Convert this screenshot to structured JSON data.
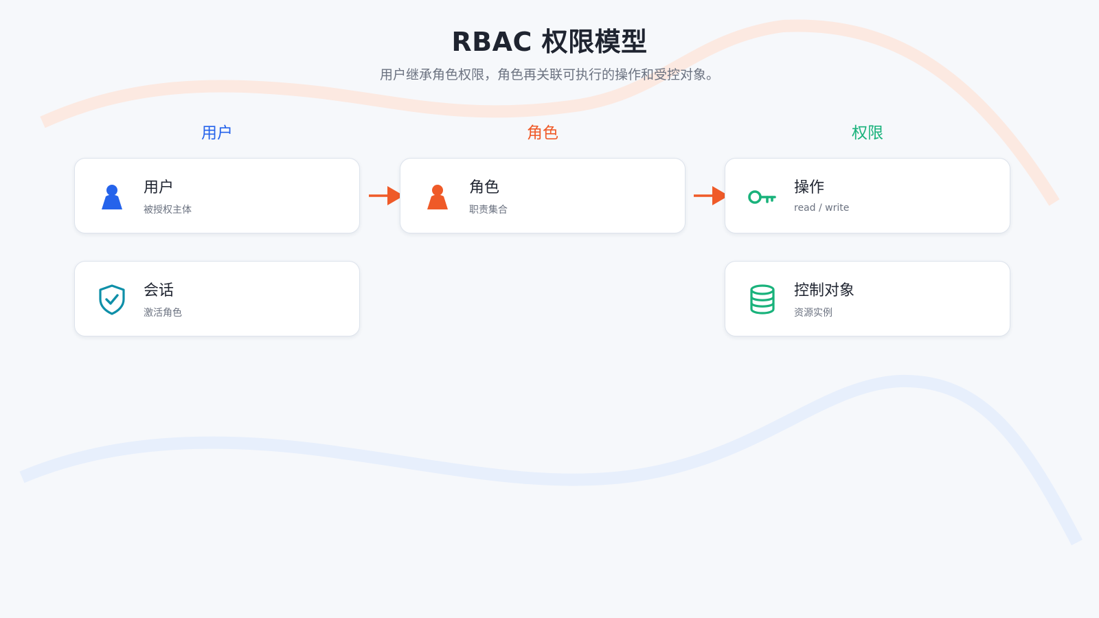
{
  "title": "RBAC 权限模型",
  "subtitle": "用户继承角色权限，角色再关联可执行的操作和受控对象。",
  "colors": {
    "blue": "#2563eb",
    "orange": "#ef5a28",
    "green": "#19b27b",
    "teal": "#0e8fa8",
    "background": "#f6f8fb",
    "wave_orange": "#fde7de",
    "wave_blue": "#e6eefc"
  },
  "columns": [
    {
      "label": "用户",
      "color": "#2563eb"
    },
    {
      "label": "角色",
      "color": "#ef5a28"
    },
    {
      "label": "权限",
      "color": "#19b27b"
    }
  ],
  "cards": {
    "user": {
      "title": "用户",
      "sub": "被授权主体",
      "icon": "user-icon",
      "color": "#2563eb"
    },
    "session": {
      "title": "会话",
      "sub": "激活角色",
      "icon": "shield-check-icon",
      "color": "#0e8fa8"
    },
    "role": {
      "title": "角色",
      "sub": "职责集合",
      "icon": "user-icon",
      "color": "#ef5a28"
    },
    "operation": {
      "title": "操作",
      "sub": "read / write",
      "icon": "key-icon",
      "color": "#19b27b"
    },
    "object": {
      "title": "控制对象",
      "sub": "资源实例",
      "icon": "database-icon",
      "color": "#19b27b"
    }
  },
  "edges": [
    {
      "from": "user",
      "to": "role",
      "icon": "arrow-right-icon",
      "color": "#ef5a28"
    },
    {
      "from": "role",
      "to": "operation",
      "icon": "arrow-right-icon",
      "color": "#ef5a28"
    }
  ]
}
